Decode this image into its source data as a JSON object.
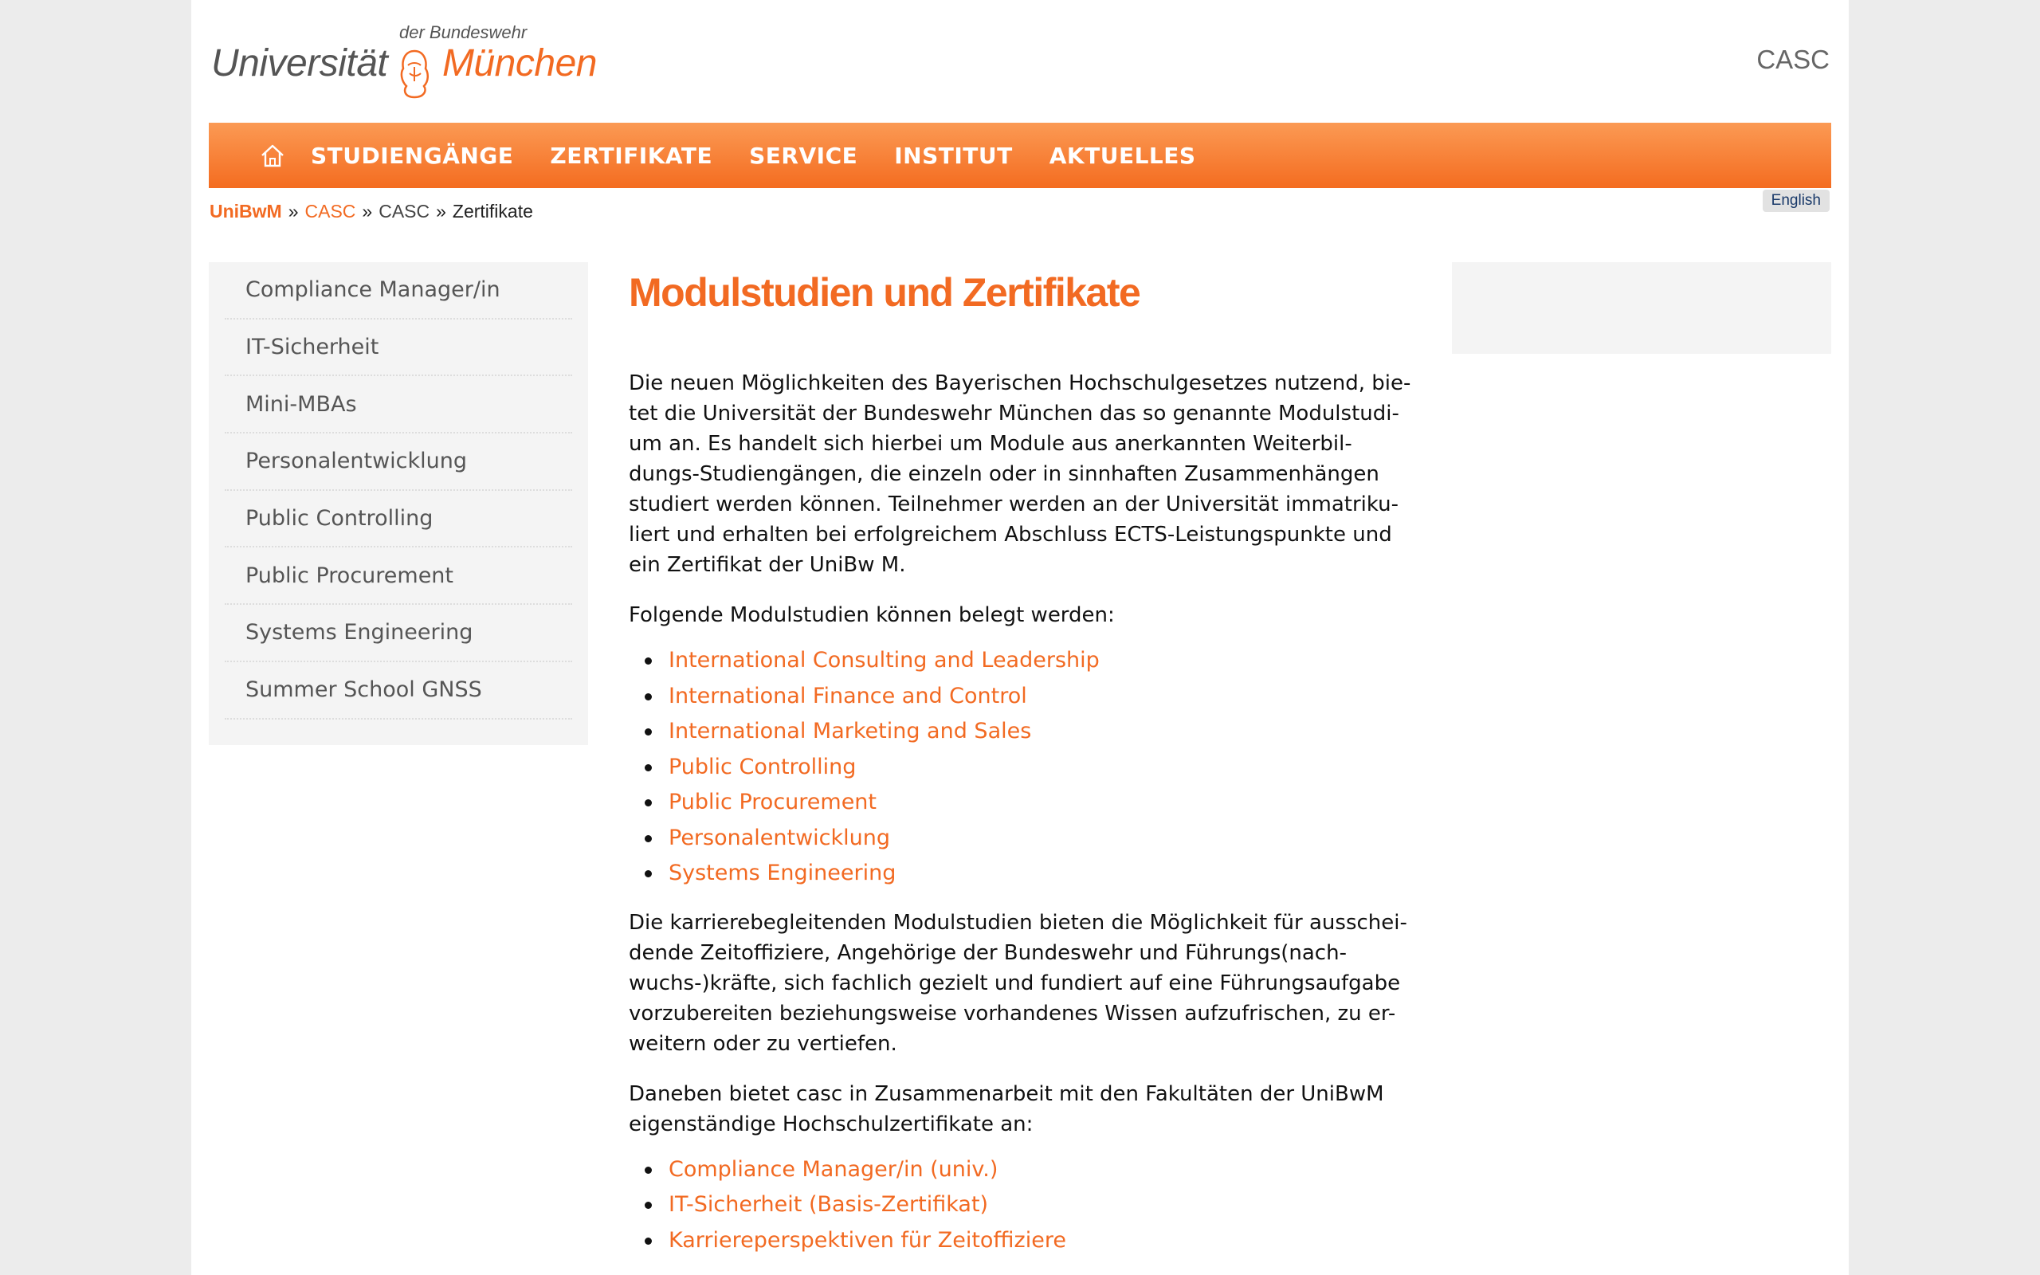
{
  "header": {
    "logo_small": "der Bundeswehr",
    "logo_left": "Universität",
    "logo_right": "München",
    "site_title": "CASC"
  },
  "nav": {
    "home_icon": "home-icon",
    "items": [
      "STUDIENGÄNGE",
      "ZERTIFIKATE",
      "SERVICE",
      "INSTITUT",
      "AKTUELLES"
    ]
  },
  "breadcrumb": {
    "items": [
      "UniBwM",
      "CASC",
      "CASC",
      "Zertifikate"
    ],
    "separator": "»"
  },
  "language_link": "English",
  "sidebar": {
    "items": [
      "Compliance Manager/in",
      "IT-Sicherheit",
      "Mini-MBAs",
      "Personalentwicklung",
      "Public Controlling",
      "Public Procurement",
      "Systems Engineering",
      "Summer School GNSS"
    ]
  },
  "content": {
    "title": "Modulstudien und Zertifikate",
    "intro_lines": [
      "Die neuen Möglichkeiten des Bayerischen Hochschulgesetzes nutzend, bie-",
      "tet die Universität der Bundeswehr München das so genannte Modulstudi-",
      "um an. Es handelt sich hierbei um Module aus anerkannten Weiterbil-",
      "dungs-Studiengängen, die einzeln oder in sinnhaften Zusammenhängen",
      "studiert werden können. Teilnehmer werden an der Universität immatriku-",
      "liert und erhalten bei erfolgreichem Abschluss ECTS-Leistungspunkte und",
      "ein Zertifikat der UniBw M."
    ],
    "list_intro": "Folgende Modulstudien können belegt werden:",
    "modules": [
      "International Consulting and Leadership",
      "International Finance and Control",
      "International Marketing and Sales",
      "Public Controlling",
      "Public Procurement",
      "Personalentwicklung",
      "Systems Engineering"
    ],
    "career_lines": [
      "Die karrierebegleitenden Modulstudien bieten die Möglichkeit für ausschei-",
      "dende Zeitoffiziere, Angehörige der Bundeswehr und Führungs(nach-",
      "wuchs-)kräfte, sich fachlich gezielt und fundiert auf eine Führungsaufgabe",
      "vorzubereiten beziehungsweise vorhandenes Wissen aufzufrischen, zu er-",
      "weitern oder zu vertiefen."
    ],
    "cert_lines": [
      "Daneben bietet casc in Zusammenarbeit mit den Fakultäten der UniBwM",
      "eigenständige Hochschulzertifikate an:"
    ],
    "certificates": [
      "Compliance Manager/in (univ.)",
      "IT-Sicherheit (Basis-Zertifikat)",
      "Karriereperspektiven für Zeitoffiziere"
    ]
  },
  "colors": {
    "accent": "#f26a22",
    "nav_gradient_top": "#fb9a54",
    "nav_gradient_bottom": "#f46c20",
    "page_bg": "#ececec",
    "panel_bg": "#f4f4f4"
  }
}
